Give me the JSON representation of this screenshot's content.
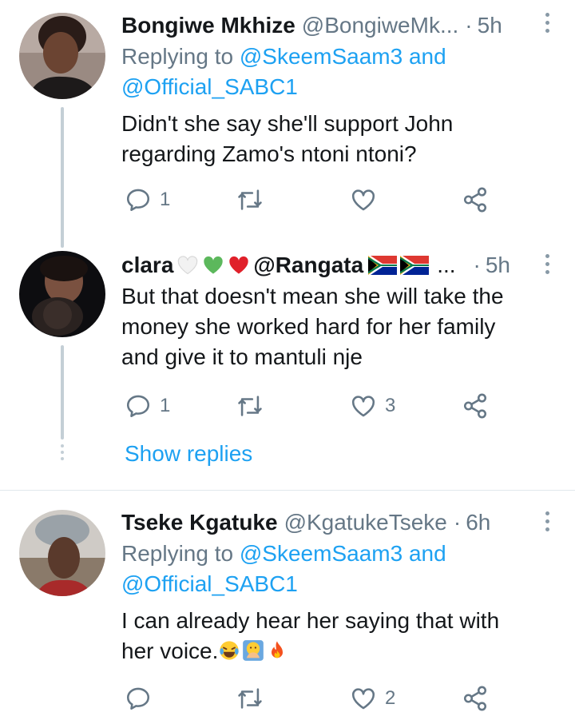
{
  "tweets": [
    {
      "name": "Bongiwe Mkhize",
      "handle": "@BongiweMk...",
      "dot": "·",
      "time": "5h",
      "replying_prefix": "Replying to ",
      "replying_1": "@SkeemSaam3",
      "replying_and": " and",
      "replying_2": "@Official_SABC1",
      "text_lines": [
        "Didn't she say she'll support John",
        "regarding Zamo's ntoni ntoni?"
      ],
      "reply_count": "1",
      "retweet_count": "",
      "like_count": ""
    },
    {
      "name": "clara",
      "handle": "@Rangata",
      "ellipsis": "...",
      "dot": "·",
      "time": "5h",
      "text_lines": [
        "But that doesn't mean she will take the",
        "money she worked hard for her family",
        "and give it to mantuli nje"
      ],
      "reply_count": "1",
      "retweet_count": "",
      "like_count": "3",
      "name_emoji": [
        "white-heart",
        "green-heart",
        "red-heart"
      ],
      "handle_emoji": [
        "south-africa-flag",
        "south-africa-flag"
      ]
    },
    {
      "name": "Tseke Kgatuke",
      "handle": "@KgatukeTseke",
      "dot": "·",
      "time": "6h",
      "replying_prefix": "Replying to ",
      "replying_1": "@SkeemSaam3",
      "replying_and": " and",
      "replying_2": "@Official_SABC1",
      "text_line1": "I can already hear her saying that with",
      "text_line2": "her voice.",
      "text_emoji": [
        "tears-of-joy-face",
        "hands-over-mouth-face",
        "fire"
      ],
      "reply_count": "",
      "retweet_count": "",
      "like_count": "2"
    }
  ],
  "show_replies": "Show replies",
  "colors": {
    "link": "#1da1f2",
    "muted": "#657786",
    "text": "#14171a",
    "thread": "#c4cfd6"
  }
}
